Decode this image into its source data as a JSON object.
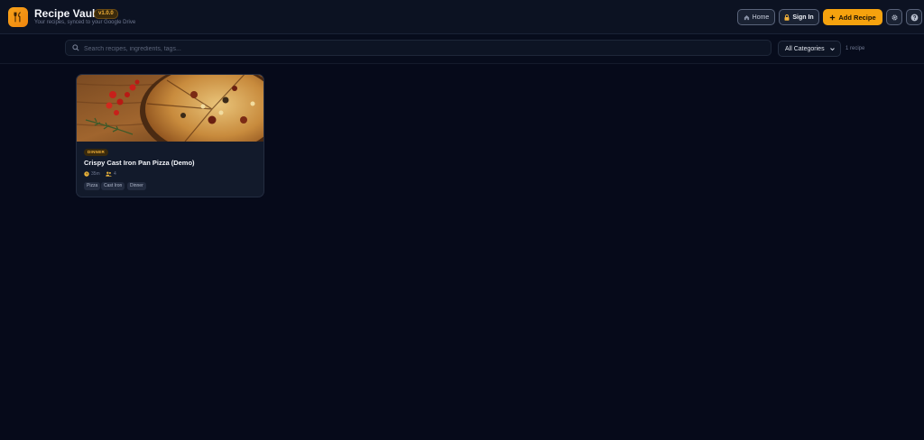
{
  "header": {
    "app_title": "Recipe Vault",
    "version": "v1.0.0",
    "subtitle": "Your recipes, synced to your Google Drive",
    "home_label": "Home",
    "signin_label": "Sign In",
    "add_label": "Add Recipe"
  },
  "search": {
    "placeholder": "Search recipes, ingredients, tags...",
    "category_selected": "All Categories",
    "count_text": "1 recipe"
  },
  "recipes": [
    {
      "category": "DINNER",
      "title": "Crispy Cast Iron Pan Pizza (Demo)",
      "time": "35m",
      "servings": "4",
      "tags": [
        "Pizza",
        "Cast Iron",
        "Dinner"
      ]
    }
  ],
  "colors": {
    "accent": "#f5a20e",
    "background": "#060a1a",
    "card": "#121a2b"
  },
  "icons": [
    "utensils-icon",
    "home-icon",
    "lock-icon",
    "plus-icon",
    "gear-icon",
    "help-icon",
    "search-icon",
    "chevron-down-icon",
    "clock-icon",
    "users-icon"
  ]
}
